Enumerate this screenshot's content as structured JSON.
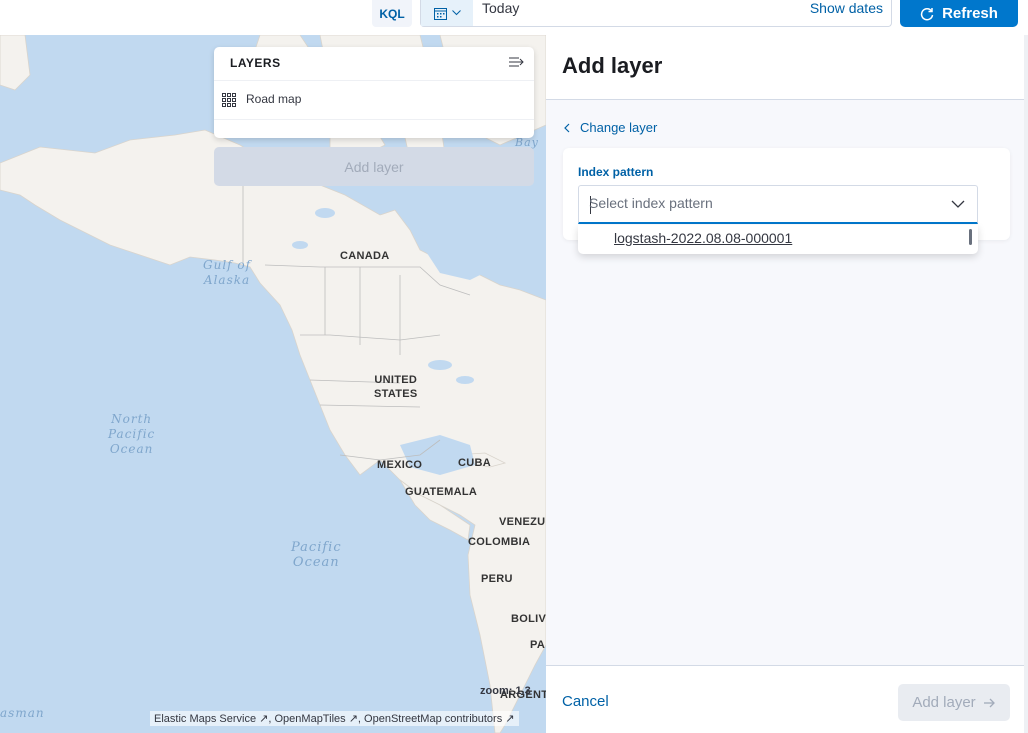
{
  "query_bar": {
    "language_label": "KQL",
    "date_value": "Today",
    "show_dates_label": "Show dates",
    "refresh_label": "Refresh"
  },
  "map": {
    "country_labels": {
      "canada": "CANADA",
      "united_states": "UNITED\nSTATES",
      "mexico": "MEXICO",
      "cuba": "CUBA",
      "guatemala": "GUATEMALA",
      "venezuela": "VENEZUE",
      "colombia": "COLOMBIA",
      "peru": "PERU",
      "bolivia": "BOLIV",
      "paraguay": "PA",
      "argentina": "ARGENT"
    },
    "water_labels": {
      "gulf_of_alaska": "Gulf of\nAlaska",
      "north_pacific": "North\nPacific\nOcean",
      "pacific": "Pacific\nOcean",
      "tasman": "asman",
      "bay": "Bay"
    },
    "zoom_label": "zoom: 1.3",
    "attribution": {
      "ems": "Elastic Maps Service",
      "omt": "OpenMapTiles",
      "osm": "OpenStreetMap contributors"
    },
    "colors": {
      "water": "#c1d9f0",
      "land": "#f4f2ee",
      "border": "#bdbdbd"
    }
  },
  "layers_panel": {
    "title": "LAYERS",
    "layers": [
      {
        "name": "Road map"
      }
    ],
    "add_layer_label": "Add layer"
  },
  "flyout": {
    "title": "Add layer",
    "change_layer_label": "Change layer",
    "index_pattern_label": "Index pattern",
    "index_pattern_placeholder": "Select index pattern",
    "options": [
      "logstash-2022.08.08-000001"
    ],
    "cancel_label": "Cancel",
    "add_layer_label": "Add layer"
  }
}
